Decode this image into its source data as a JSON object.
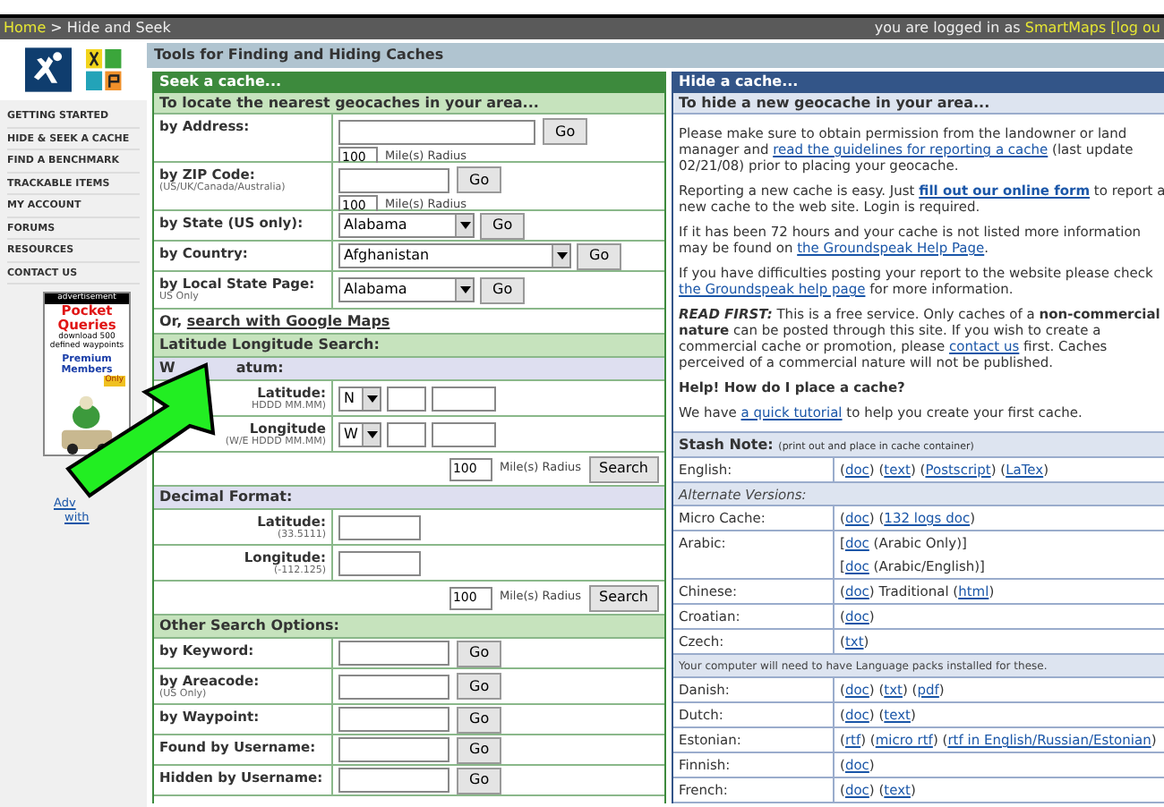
{
  "breadcrumb": {
    "home": "Home",
    "rest": "> Hide and Seek"
  },
  "login": {
    "text": "you are logged in as",
    "user": "SmartMaps",
    "logout": "[log ou"
  },
  "nav": [
    "GETTING STARTED",
    "HIDE & SEEK A CACHE",
    "FIND A BENCHMARK",
    "TRACKABLE ITEMS",
    "MY ACCOUNT",
    "FORUMS",
    "RESOURCES",
    "CONTACT US"
  ],
  "ad": {
    "label": "advertisement",
    "title": "Pocket Queries",
    "line": "download 500 defined waypoints",
    "members": "Premium Members",
    "only": "Only",
    "link_1": "Adv",
    "link_2": "with"
  },
  "page_title": "Tools for Finding and Hiding Caches",
  "seek": {
    "header": "Seek a cache...",
    "subheader": "To locate the nearest geocaches in your area...",
    "rows": [
      {
        "kind": "text_radius",
        "label": "by Address:",
        "wide": true,
        "radius": "100",
        "radius_label": "Mile(s) Radius",
        "button": "Go"
      },
      {
        "kind": "text_radius",
        "label": "by ZIP Code:",
        "note": "(US/UK/Canada/Australia)",
        "wide": false,
        "radius": "100",
        "radius_label": "Mile(s) Radius",
        "button": "Go"
      },
      {
        "kind": "select",
        "label": "by State (US only):",
        "value": "Alabama",
        "wide": false,
        "button": "Go"
      },
      {
        "kind": "select",
        "label": "by Country:",
        "value": "Afghanistan",
        "wide": true,
        "button": "Go"
      },
      {
        "kind": "select",
        "label": "by Local State Page:",
        "note": "US Only",
        "value": "Alabama",
        "wide": false,
        "button": "Go"
      },
      {
        "kind": "link",
        "prefix": "Or,",
        "link": "search with Google Maps"
      },
      {
        "kind": "group",
        "text": "Latitude Longitude Search:"
      },
      {
        "kind": "subgroup",
        "text": "W",
        "text_2": "atum:"
      },
      {
        "kind": "coord",
        "label": "Latitude:",
        "note": "HDDD MM.MM)",
        "hemisphere": "N"
      },
      {
        "kind": "coord",
        "label": "Longitude",
        "note": "(W/E HDDD MM.MM)",
        "hemisphere": "W"
      },
      {
        "kind": "search",
        "radius": "100",
        "radius_label": "Mile(s) Radius",
        "button": "Search"
      },
      {
        "kind": "subgroup",
        "text": "Decimal Format:"
      },
      {
        "kind": "decimal",
        "label": "Latitude:",
        "note": "(33.5111)"
      },
      {
        "kind": "decimal",
        "label": "Longitude:",
        "note": "(-112.125)"
      },
      {
        "kind": "search",
        "radius": "100",
        "radius_label": "Mile(s) Radius",
        "button": "Search"
      },
      {
        "kind": "group",
        "text": "Other Search Options:"
      },
      {
        "kind": "text",
        "label": "by Keyword:",
        "button": "Go"
      },
      {
        "kind": "text",
        "label": "by Areacode:",
        "note": "(US Only)",
        "button": "Go"
      },
      {
        "kind": "text",
        "label": "by Waypoint:",
        "button": "Go"
      },
      {
        "kind": "text",
        "label": "Found by Username:",
        "button": "Go"
      },
      {
        "kind": "text",
        "label": "Hidden by Username:",
        "button": "Go"
      }
    ]
  },
  "hide": {
    "header": "Hide a cache...",
    "subheader": "To hide a new geocache in your area...",
    "paragraphs": [
      {
        "kind": "text",
        "parts": [
          "Please make sure to obtain permission from the landowner or land manager and ",
          {
            "kind": "link",
            "t": "read the guidelines for reporting a cache"
          },
          " (last update 02/21/08) prior to placing your geocache."
        ]
      },
      {
        "kind": "text",
        "parts": [
          "Reporting a new cache is easy. Just ",
          {
            "kind": "bold_link",
            "t": "fill out our online form"
          },
          " to report a new cache to the web site. Login is required."
        ]
      },
      {
        "kind": "text",
        "parts": [
          "If it has been 72 hours and your cache is not listed more information may be found on ",
          {
            "kind": "link",
            "t": "the Groundspeak Help Page"
          },
          "."
        ]
      },
      {
        "kind": "text",
        "parts": [
          "If you have difficulties posting your report to the website please check ",
          {
            "kind": "link",
            "t": "the Groundspeak help page"
          },
          " for more information."
        ]
      },
      {
        "kind": "text",
        "parts": [
          {
            "kind": "bold_italic",
            "t": "READ FIRST:"
          },
          " This is a free service. Only caches of a ",
          {
            "kind": "bold",
            "t": "non-commercial nature"
          },
          " can be posted through this site. If you wish to create a commercial cache or promotion, please ",
          {
            "kind": "link",
            "t": "contact us"
          },
          " first. Caches perceived of a commercial nature will not be published."
        ]
      },
      {
        "kind": "heading",
        "parts": [
          "Help! How do I place a cache?"
        ]
      },
      {
        "kind": "text",
        "parts": [
          "We have ",
          {
            "kind": "link",
            "t": "a quick tutorial"
          },
          " to help you create your first cache."
        ]
      }
    ]
  },
  "stash": {
    "title": "Stash Note:",
    "note": "(print out and place in cache container)",
    "rows": [
      {
        "kind": "row",
        "label": "English:",
        "lines": [
          [
            "(",
            {
              "t": "doc"
            },
            ") (",
            {
              "t": "text"
            },
            ") (",
            {
              "t": "Postscript"
            },
            ") (",
            {
              "t": "LaTex"
            },
            ")"
          ]
        ]
      },
      {
        "kind": "sub",
        "label": "Alternate Versions:"
      },
      {
        "kind": "row",
        "label": "Micro Cache:",
        "lines": [
          [
            "(",
            {
              "t": "doc"
            },
            ") (",
            {
              "t": "132 logs doc"
            },
            ")"
          ]
        ]
      },
      {
        "kind": "row",
        "label": "Arabic:",
        "lines": [
          [
            "[",
            {
              "t": "doc"
            },
            " (Arabic Only)]"
          ],
          [
            "[",
            {
              "t": "doc"
            },
            " (Arabic/English)]"
          ]
        ]
      },
      {
        "kind": "row",
        "label": "Chinese:",
        "lines": [
          [
            "(",
            {
              "t": "doc"
            },
            ") Traditional (",
            {
              "t": "html"
            },
            ")"
          ]
        ]
      },
      {
        "kind": "row",
        "label": "Croatian:",
        "lines": [
          [
            "(",
            {
              "t": "doc"
            },
            ")"
          ]
        ]
      },
      {
        "kind": "row",
        "label": "Czech:",
        "lines": [
          [
            "(",
            {
              "t": "txt"
            },
            ")"
          ]
        ]
      },
      {
        "kind": "note",
        "label": "Your computer will need to have Language packs installed for these."
      },
      {
        "kind": "row",
        "label": "Danish:",
        "lines": [
          [
            "(",
            {
              "t": "doc"
            },
            ") (",
            {
              "t": "txt"
            },
            ") (",
            {
              "t": "pdf"
            },
            ")"
          ]
        ]
      },
      {
        "kind": "row",
        "label": "Dutch:",
        "lines": [
          [
            "(",
            {
              "t": "doc"
            },
            ") (",
            {
              "t": "text"
            },
            ")"
          ]
        ]
      },
      {
        "kind": "row",
        "label": "Estonian:",
        "lines": [
          [
            "(",
            {
              "t": "rtf"
            },
            ") (",
            {
              "t": "micro rtf"
            },
            ") (",
            {
              "t": "rtf in English/Russian/Estonian"
            },
            ")"
          ]
        ]
      },
      {
        "kind": "row",
        "label": "Finnish:",
        "lines": [
          [
            "(",
            {
              "t": "doc"
            },
            ")"
          ]
        ]
      },
      {
        "kind": "row",
        "label": "French:",
        "lines": [
          [
            "(",
            {
              "t": "doc"
            },
            ") (",
            {
              "t": "text"
            },
            ")"
          ]
        ]
      }
    ]
  }
}
